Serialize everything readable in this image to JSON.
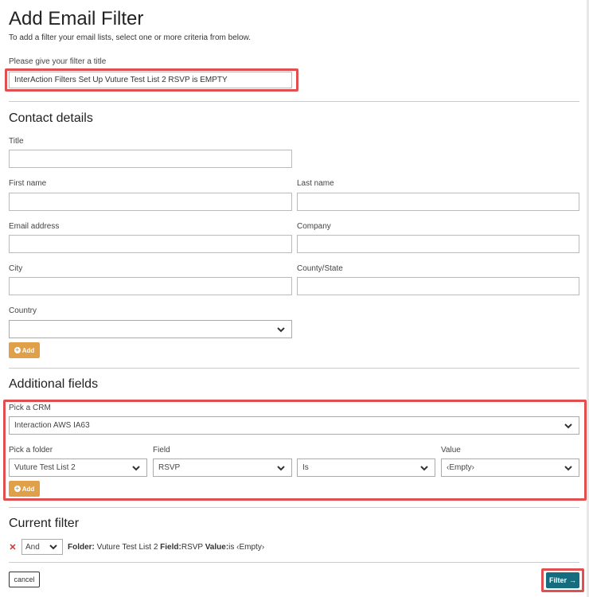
{
  "header": {
    "title": "Add Email Filter",
    "lead": "To add a filter your email lists, select one or more criteria from below."
  },
  "filter_title": {
    "label": "Please give your filter a title",
    "value": "InterAction Filters Set Up Vuture Test List 2 RSVP is EMPTY"
  },
  "contact": {
    "heading": "Contact details",
    "title_label": "Title",
    "first_name_label": "First name",
    "last_name_label": "Last name",
    "email_label": "Email address",
    "company_label": "Company",
    "city_label": "City",
    "county_label": "County/State",
    "country_label": "Country",
    "country_value": "",
    "add_label": "Add"
  },
  "additional": {
    "heading": "Additional fields",
    "crm_label": "Pick a CRM",
    "crm_value": "Interaction AWS IA63",
    "folder_label": "Pick a folder",
    "folder_value": "Vuture Test List 2",
    "field_label": "Field",
    "field_value": "RSVP",
    "operator_value": "Is",
    "value_label": "Value",
    "value_value": "‹Empty›",
    "add_label": "Add"
  },
  "current": {
    "heading": "Current filter",
    "conjunction": "And",
    "folder_key": "Folder:",
    "folder_val": "Vuture Test List 2",
    "field_key": "Field:",
    "field_val": "RSVP",
    "value_key": "Value:",
    "value_val": "is ‹Empty›"
  },
  "footer": {
    "cancel_label": "cancel",
    "filter_label": "Filter",
    "filter_arrow": "→"
  },
  "colors": {
    "highlight": "#e05050",
    "add_button": "#e0a04a",
    "filter_button": "#146c7e"
  }
}
